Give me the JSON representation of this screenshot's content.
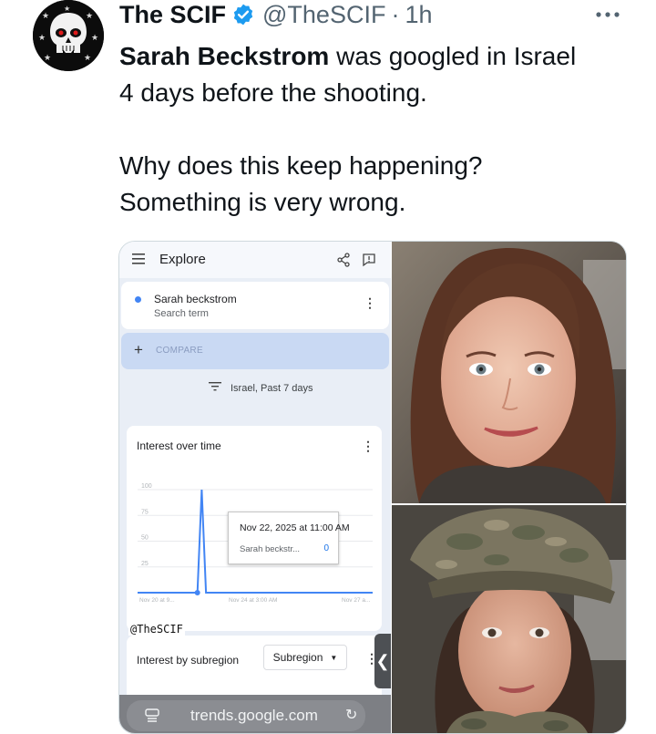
{
  "tweet": {
    "author_name": "The SCIF",
    "handle": "@TheSCIF",
    "separator": "·",
    "time": "1h",
    "text_bold": "Sarah Beckstrom",
    "text_line1_rest": " was googled in Israel",
    "text_line2": "4 days before the shooting.",
    "text_line3": "Why does this keep happening?",
    "text_line4": "Something is very wrong.",
    "verified_color": "#1d9bf0"
  },
  "trends": {
    "header_title": "Explore",
    "search_term": "Sarah beckstrom",
    "search_term_sub": "Search term",
    "compare_label": "COMPARE",
    "filter_label": "Israel, Past 7 days",
    "interest_title": "Interest over time",
    "tooltip_date": "Nov 22, 2025 at 11:00 AM",
    "tooltip_series": "Sarah beckstr...",
    "tooltip_value": "0",
    "watermark": "@TheSCIF",
    "subregion_title": "Interest by subregion",
    "subregion_button": "Subregion",
    "url": "trends.google.com",
    "series_color": "#4285f4"
  },
  "chart_data": {
    "type": "line",
    "x_tick_labels": [
      "Nov 20 at 9...",
      "Nov 24 at 3:00 AM",
      "Nov 27 a..."
    ],
    "y_tick_labels": [
      "100",
      "75",
      "50",
      "25"
    ],
    "ylim": [
      0,
      100
    ],
    "series": [
      {
        "values": [
          0,
          0,
          0,
          0,
          0,
          0,
          0,
          0,
          0,
          0,
          0,
          0,
          0,
          0,
          0,
          100,
          0,
          0,
          0,
          0,
          0,
          0,
          0,
          0,
          0,
          0,
          0,
          0,
          0,
          0,
          0,
          0,
          0,
          0,
          0,
          0,
          0,
          0,
          0,
          0,
          0,
          0,
          0,
          0,
          0,
          0,
          0,
          0,
          0,
          0,
          0,
          0,
          0,
          0,
          0,
          0
        ]
      }
    ]
  }
}
